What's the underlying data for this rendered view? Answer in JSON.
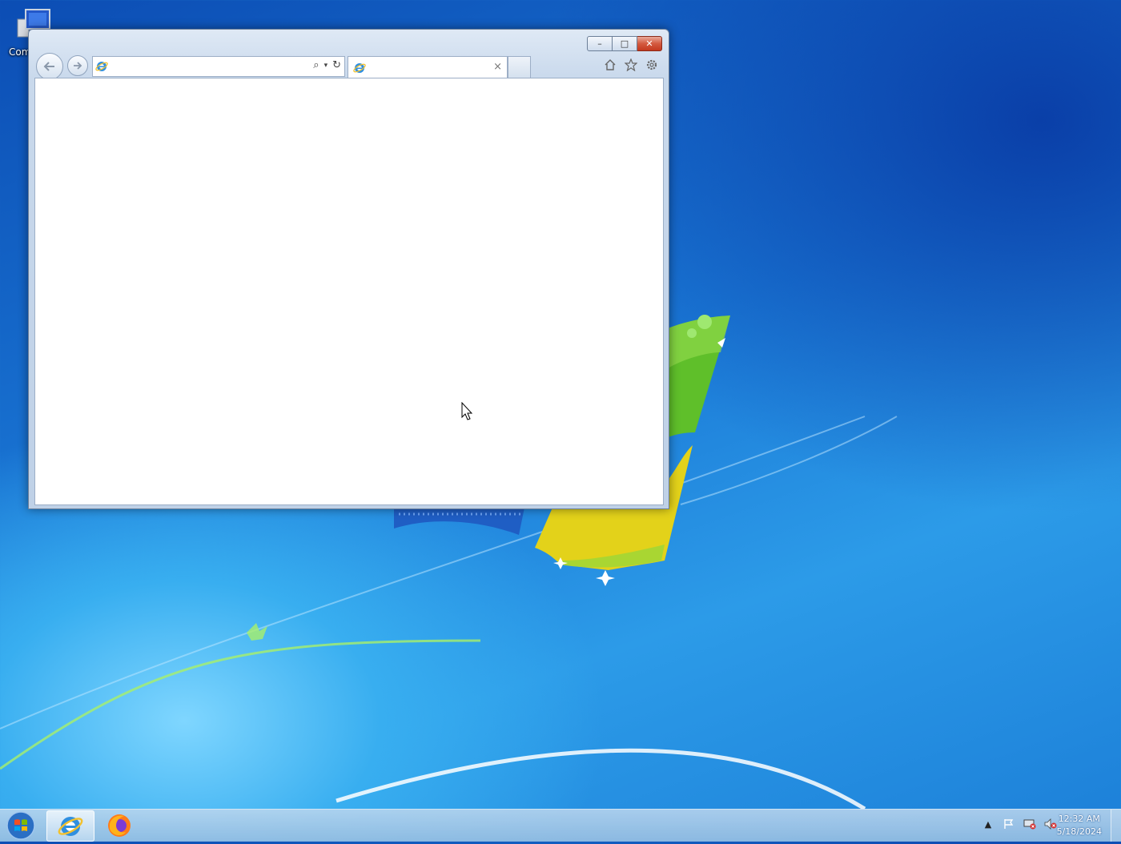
{
  "desktop": {
    "icon_label": "Com"
  },
  "browser": {
    "address_value": "",
    "tab_title": "",
    "tab_close_glyph": "×",
    "window_buttons": {
      "minimize": "–",
      "maximize": "□",
      "close": "✕"
    }
  },
  "taskbar": {
    "items": [
      "Internet Explorer",
      "Firefox"
    ],
    "clock_time": "12:32 AM",
    "clock_date": "5/18/2024"
  },
  "colors": {
    "desktop_blue": "#1a78d6",
    "close_red": "#c4391f",
    "taskbar": "#a9c8e6"
  }
}
